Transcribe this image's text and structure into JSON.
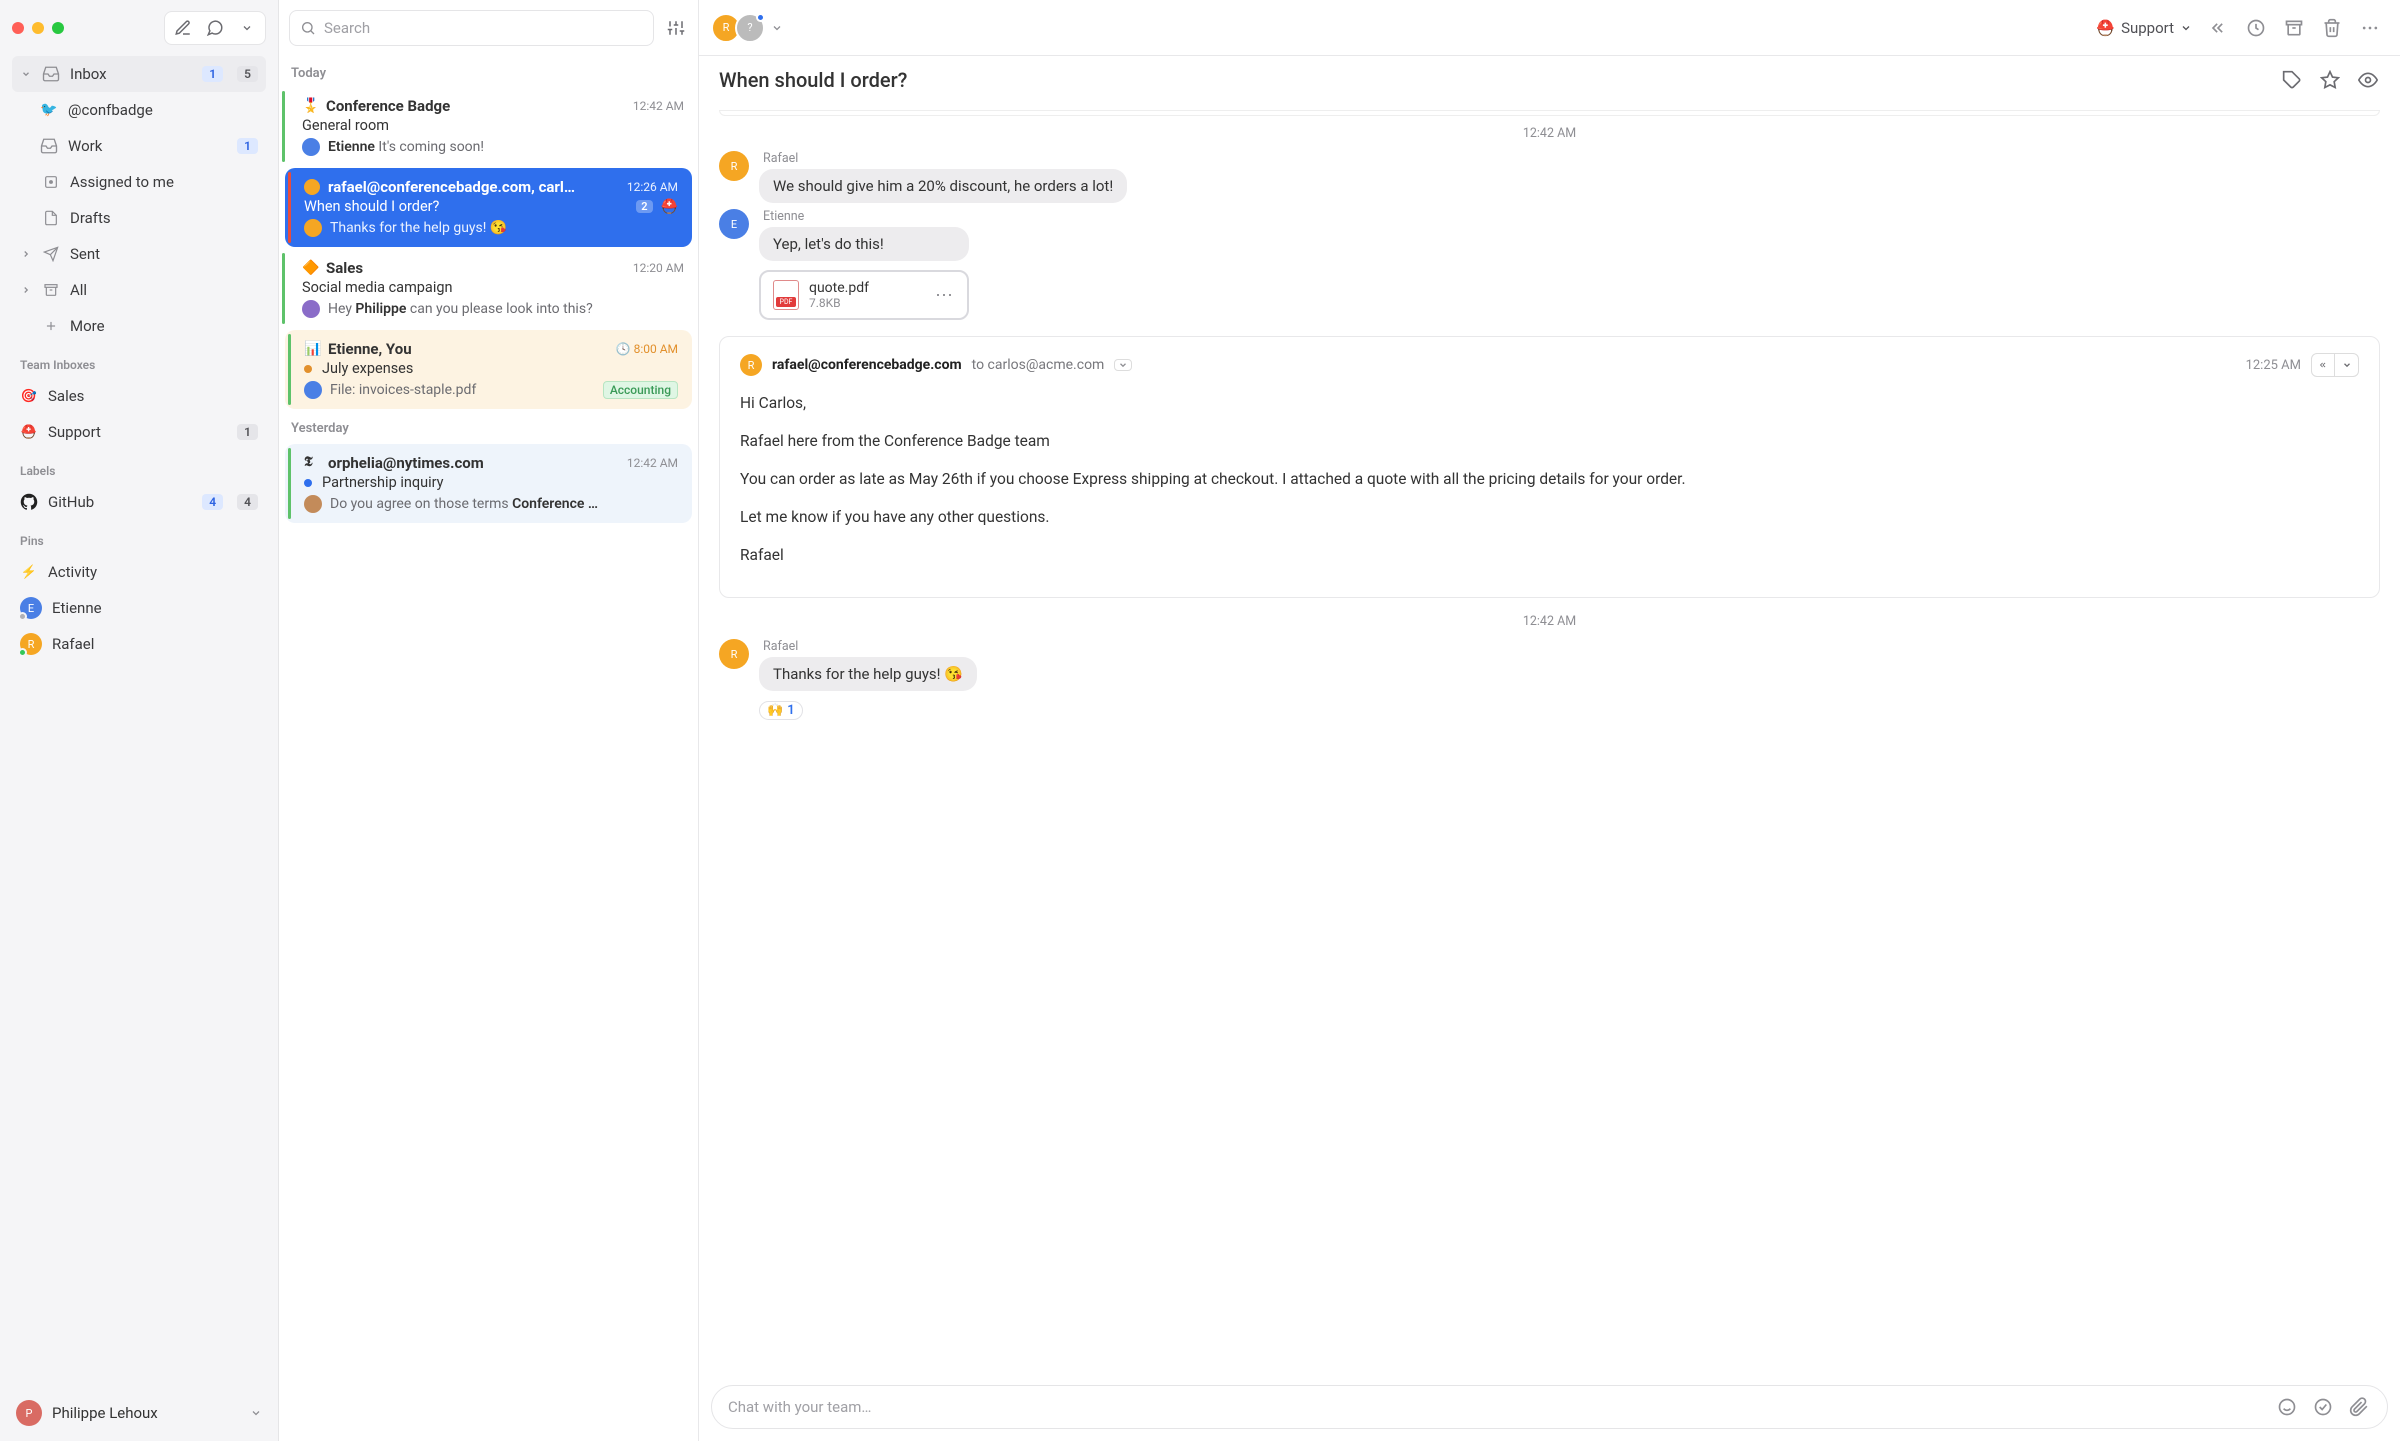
{
  "search_placeholder": "Search",
  "composer_placeholder": "Chat with your team…",
  "sidebar": {
    "nav": {
      "inbox": {
        "label": "Inbox",
        "unread": "1",
        "total": "5"
      },
      "confbadge": {
        "label": "@confbadge"
      },
      "work": {
        "label": "Work",
        "unread": "1"
      },
      "assigned": {
        "label": "Assigned to me"
      },
      "drafts": {
        "label": "Drafts"
      },
      "sent": {
        "label": "Sent"
      },
      "all": {
        "label": "All"
      },
      "more": {
        "label": "More"
      }
    },
    "sections": {
      "team": "Team Inboxes",
      "labels": "Labels",
      "pins": "Pins"
    },
    "team": {
      "sales": "Sales",
      "support": {
        "label": "Support",
        "count": "1"
      }
    },
    "labels": {
      "github": {
        "label": "GitHub",
        "blue": "4",
        "gray": "4"
      }
    },
    "pins": {
      "activity": "Activity",
      "etienne": "Etienne",
      "rafael": "Rafael"
    },
    "footer_name": "Philippe Lehoux"
  },
  "threads": {
    "date_today": "Today",
    "date_yesterday": "Yesterday",
    "items": [
      {
        "title": "Conference Badge",
        "time": "12:42 AM",
        "subject": "General room",
        "snippet_name": "Etienne",
        "snippet_text": " It's coming soon!"
      },
      {
        "title": "rafael@conferencebadge.com, carl…",
        "time": "12:26 AM",
        "subject": "When should I order?",
        "snippet_text": "Thanks for the help guys! 😘",
        "count": "2"
      },
      {
        "title": "Sales",
        "time": "12:20 AM",
        "subject": "Social media campaign",
        "snippet_pre": "Hey ",
        "snippet_name": "Philippe",
        "snippet_text": " can you please look into this?"
      },
      {
        "title": "Etienne, You",
        "time": "8:00 AM",
        "subject": "July expenses",
        "snippet_text": "File: invoices-staple.pdf",
        "tag": "Accounting"
      },
      {
        "title": "orphelia@nytimes.com",
        "time": "12:42 AM",
        "subject": "Partnership inquiry",
        "snippet_pre": "Do you agree on those terms ",
        "snippet_name": "Conference …"
      }
    ]
  },
  "reader": {
    "team_select": "Support",
    "subject": "When should I order?",
    "ts1": "12:42 AM",
    "ts2": "12:42 AM",
    "msgs": {
      "m1_name": "Rafael",
      "m1_text": "We should give him a 20% discount, he orders a lot!",
      "m2_name": "Etienne",
      "m2_text": "Yep, let's do this!",
      "att_name": "quote.pdf",
      "att_size": "7.8KB",
      "m3_name": "Rafael",
      "m3_text": "Thanks for the help guys! 😘",
      "reaction_emoji": "🙌",
      "reaction_count": "1"
    },
    "email": {
      "from": "rafael@conferencebadge.com",
      "to_prefix": "to ",
      "to": "carlos@acme.com",
      "time": "12:25 AM",
      "p1": "Hi Carlos,",
      "p2": "Rafael here from the Conference Badge team",
      "p3": "You can order as late as May 26th if you choose Express shipping at checkout. I attached a quote with all the pricing details for your order.",
      "p4": "Let me know if you have any other questions.",
      "p5": "Rafael"
    }
  }
}
